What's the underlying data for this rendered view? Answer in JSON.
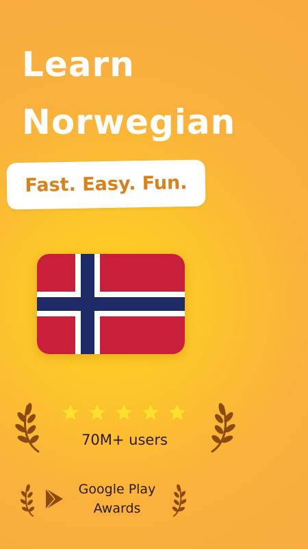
{
  "headline": {
    "line1": "Learn",
    "line2": "Norwegian"
  },
  "tagline": "Fast. Easy. Fun.",
  "flag": {
    "icon": "norway-flag-icon",
    "colors": {
      "red": "#C8203A",
      "blue": "#1E2A66",
      "white": "#FFFFFF"
    }
  },
  "rating": {
    "stars": 5,
    "star_color": "#FFE032",
    "users_label": "70M+ users"
  },
  "award": {
    "icon": "google-play-icon",
    "line1": "Google Play",
    "line2": "Awards"
  },
  "colors": {
    "background": "#F9B03D",
    "accent": "#D9811A",
    "laurel": "#8A4A12",
    "text_dark": "#2B1A0A"
  }
}
